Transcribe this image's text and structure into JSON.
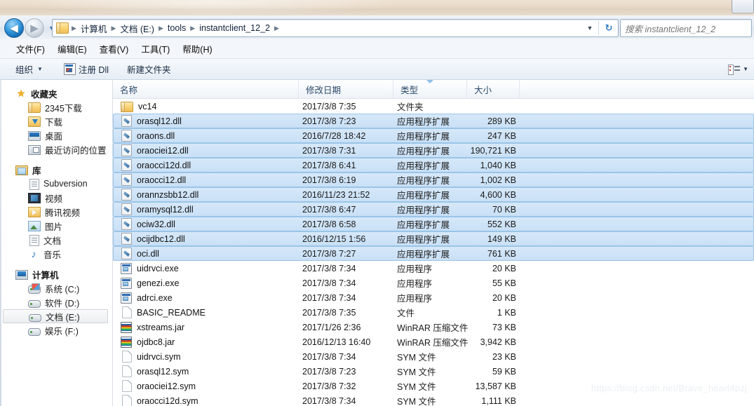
{
  "window": {
    "titlebar_color": "#e4d6c4",
    "controls": [
      "restore"
    ]
  },
  "nav": {
    "back_label": "◀",
    "forward_label": "▶",
    "dropdown_label": "▼",
    "address": {
      "icon": "folder-icon",
      "crumbs": [
        "计算机",
        "文档 (E:)",
        "tools",
        "instantclient_12_2"
      ],
      "separator": "▶",
      "history_chevron": "▼",
      "refresh_label": "↻"
    },
    "search": {
      "placeholder": "搜索 instantclient_12_2",
      "value": ""
    }
  },
  "menubar": {
    "items": [
      "文件(F)",
      "编辑(E)",
      "查看(V)",
      "工具(T)",
      "帮助(H)"
    ]
  },
  "commandbar": {
    "organize_label": "组织",
    "organize_caret": "▼",
    "register_dll_label": "注册 Dll",
    "new_folder_label": "新建文件夹",
    "view_caret": "▼"
  },
  "sidebar": {
    "groups": [
      {
        "header": {
          "label": "收藏夹",
          "icon": "star-icon"
        },
        "items": [
          {
            "label": "2345下载",
            "icon": "folder-icon"
          },
          {
            "label": "下载",
            "icon": "downloads-folder-icon"
          },
          {
            "label": "桌面",
            "icon": "desktop-icon"
          },
          {
            "label": "最近访问的位置",
            "icon": "recent-places-icon"
          }
        ]
      },
      {
        "header": {
          "label": "库",
          "icon": "library-icon"
        },
        "items": [
          {
            "label": "Subversion",
            "icon": "document-icon"
          },
          {
            "label": "视频",
            "icon": "video-icon"
          },
          {
            "label": "腾讯视频",
            "icon": "tencent-video-icon"
          },
          {
            "label": "图片",
            "icon": "pictures-icon"
          },
          {
            "label": "文档",
            "icon": "document-icon"
          },
          {
            "label": "音乐",
            "icon": "music-icon"
          }
        ]
      },
      {
        "header": {
          "label": "计算机",
          "icon": "computer-icon"
        },
        "items": [
          {
            "label": "系统 (C:)",
            "icon": "system-drive-icon",
            "selected": false
          },
          {
            "label": "软件 (D:)",
            "icon": "drive-icon",
            "selected": false
          },
          {
            "label": "文档 (E:)",
            "icon": "drive-icon",
            "selected": true
          },
          {
            "label": "娱乐 (F:)",
            "icon": "drive-icon",
            "selected": false
          }
        ]
      }
    ]
  },
  "filelist": {
    "columns": [
      {
        "label": "名称",
        "sorted": false
      },
      {
        "label": "修改日期",
        "sorted": false
      },
      {
        "label": "类型",
        "sorted": true
      },
      {
        "label": "大小",
        "sorted": false
      }
    ],
    "rows": [
      {
        "name": "vc14",
        "date": "2017/3/8 7:35",
        "type": "文件夹",
        "size": "",
        "icon": "folder-icon",
        "selected": false
      },
      {
        "name": "orasql12.dll",
        "date": "2017/3/8 7:23",
        "type": "应用程序扩展",
        "size": "289 KB",
        "icon": "dll-icon",
        "selected": true
      },
      {
        "name": "oraons.dll",
        "date": "2016/7/28 18:42",
        "type": "应用程序扩展",
        "size": "247 KB",
        "icon": "dll-icon",
        "selected": true
      },
      {
        "name": "oraociei12.dll",
        "date": "2017/3/8 7:31",
        "type": "应用程序扩展",
        "size": "190,721 KB",
        "icon": "dll-icon",
        "selected": true
      },
      {
        "name": "oraocci12d.dll",
        "date": "2017/3/8 6:41",
        "type": "应用程序扩展",
        "size": "1,040 KB",
        "icon": "dll-icon",
        "selected": true
      },
      {
        "name": "oraocci12.dll",
        "date": "2017/3/8 6:19",
        "type": "应用程序扩展",
        "size": "1,002 KB",
        "icon": "dll-icon",
        "selected": true
      },
      {
        "name": "orannzsbb12.dll",
        "date": "2016/11/23 21:52",
        "type": "应用程序扩展",
        "size": "4,600 KB",
        "icon": "dll-icon",
        "selected": true
      },
      {
        "name": "oramysql12.dll",
        "date": "2017/3/8 6:47",
        "type": "应用程序扩展",
        "size": "70 KB",
        "icon": "dll-icon",
        "selected": true
      },
      {
        "name": "ociw32.dll",
        "date": "2017/3/8 6:58",
        "type": "应用程序扩展",
        "size": "552 KB",
        "icon": "dll-icon",
        "selected": true
      },
      {
        "name": "ocijdbc12.dll",
        "date": "2016/12/15 1:56",
        "type": "应用程序扩展",
        "size": "149 KB",
        "icon": "dll-icon",
        "selected": true
      },
      {
        "name": "oci.dll",
        "date": "2017/3/8 7:27",
        "type": "应用程序扩展",
        "size": "761 KB",
        "icon": "dll-icon",
        "selected": true
      },
      {
        "name": "uidrvci.exe",
        "date": "2017/3/8 7:34",
        "type": "应用程序",
        "size": "20 KB",
        "icon": "exe-icon",
        "selected": false
      },
      {
        "name": "genezi.exe",
        "date": "2017/3/8 7:34",
        "type": "应用程序",
        "size": "55 KB",
        "icon": "exe-icon",
        "selected": false
      },
      {
        "name": "adrci.exe",
        "date": "2017/3/8 7:34",
        "type": "应用程序",
        "size": "20 KB",
        "icon": "exe-icon",
        "selected": false
      },
      {
        "name": "BASIC_README",
        "date": "2017/3/8 7:35",
        "type": "文件",
        "size": "1 KB",
        "icon": "file-icon",
        "selected": false
      },
      {
        "name": "xstreams.jar",
        "date": "2017/1/26 2:36",
        "type": "WinRAR 压缩文件",
        "size": "73 KB",
        "icon": "archive-icon",
        "selected": false
      },
      {
        "name": "ojdbc8.jar",
        "date": "2016/12/13 16:40",
        "type": "WinRAR 压缩文件",
        "size": "3,942 KB",
        "icon": "archive-icon",
        "selected": false
      },
      {
        "name": "uidrvci.sym",
        "date": "2017/3/8 7:34",
        "type": "SYM 文件",
        "size": "23 KB",
        "icon": "file-icon",
        "selected": false
      },
      {
        "name": "orasql12.sym",
        "date": "2017/3/8 7:23",
        "type": "SYM 文件",
        "size": "59 KB",
        "icon": "file-icon",
        "selected": false
      },
      {
        "name": "oraociei12.sym",
        "date": "2017/3/8 7:32",
        "type": "SYM 文件",
        "size": "13,587 KB",
        "icon": "file-icon",
        "selected": false
      },
      {
        "name": "oraocci12d.sym",
        "date": "2017/3/8 7:34",
        "type": "SYM 文件",
        "size": "1,111 KB",
        "icon": "file-icon",
        "selected": false
      }
    ]
  },
  "watermark": {
    "text": "https://blog.csdn.net/Brave_heart4pzj"
  }
}
